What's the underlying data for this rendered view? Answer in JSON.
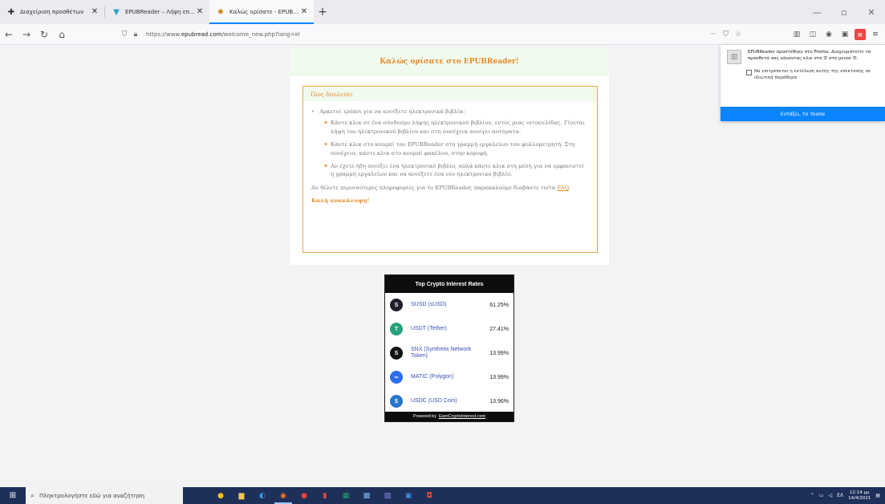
{
  "tabs": [
    {
      "title": "Διαχείριση προσθέτων",
      "icon": "puzzle-icon",
      "active": false
    },
    {
      "title": "EPUBReader – Λήψη επέκταση",
      "icon": "epubreader-icon",
      "active": false
    },
    {
      "title": "Καλώς ορίσατε - EPUBReader",
      "icon": "epubreader-icon",
      "active": true
    }
  ],
  "nav": {
    "url_prefix": "https://www.",
    "url_domain": "epubread.com",
    "url_path": "/welcome_new.php?lang=el",
    "url_more": "···"
  },
  "welcome": {
    "title": "Καλώς ορίσατε στο EPUBReader!",
    "howto_title": "Πώς δουλεύει",
    "intro": "Αρκετοί τρόποι για να ανοίξετε ηλεκτρονικά βιβλία:",
    "steps": [
      "Κάντε κλικ σε ένα σύνδεσμο λήψης ηλεκτρονικού βιβλίου, εντός μιας ιστοσελίδας. Γίνεται λήψη του ηλεκτρονικού βιβλίου και στη συνέχεια ανοίγει αυτόματα.",
      "Κάντε κλικ στο κουμπί του EPUBReader στη γραμμή εργαλείων του φυλλομετρητή. Στη συνέχεια, κάντε κλικ στο κουμπί φακέλου, στην κορυφή.",
      "Αν έχετε ήδη ανοίξει ένα ηλεκτρονικό βιβλίο, απλά κάντε κλικ στη μέση για να εμφανιστεί η γραμμή εργαλείων και να ανοίξετε ένα νέο ηλεκτρονικό βιβλίο."
    ],
    "more_info": "Αν θέλετε περισσότερες πληροφορίες για το EPUBReader, παρακαλούμε διαβάστε το/τα",
    "faq_link": "FAQ",
    "more_info_end": ".",
    "enjoy": "Καλή ανακάλυψη!"
  },
  "crypto": {
    "title": "Top Crypto Interest Rates",
    "rows": [
      {
        "name": "SUSD (sUSD)",
        "rate": "61.25%",
        "icon": "susd-icon",
        "color": "#1f1f2b"
      },
      {
        "name": "USDT (Tether)",
        "rate": "27.41%",
        "icon": "tether-icon",
        "color": "#26a17b"
      },
      {
        "name": "SNX (Synthetix Network Token)",
        "rate": "13.99%",
        "icon": "snx-icon",
        "color": "#111111"
      },
      {
        "name": "MATIC (Polygon)",
        "rate": "13.99%",
        "icon": "polygon-icon",
        "color": "#2b6def"
      },
      {
        "name": "USDC (USD Coin)",
        "rate": "13.96%",
        "icon": "usdc-icon",
        "color": "#2775ca"
      }
    ],
    "footer_prefix": "Powered by",
    "footer_link": "EarnCryptoInterest.com"
  },
  "popup": {
    "text": "EPUBReader προστέθηκε στο Firefox. Διαχειριστείτε τα πρόσθετά σας κάνοντας κλικ στο ☰ στο μενού ☰.",
    "checkbox_label": "Να επιτρέπεται η εκτέλεση αυτής της επέκτασης σε ιδιωτικά παράθυρα",
    "button": "Εντάξει, το 'πιασα"
  },
  "taskbar": {
    "search_placeholder": "Πληκτρολογήστε εδώ για αναζήτηση",
    "language": "ΕΛ",
    "time": "12:14 μμ",
    "date": "14/4/2021"
  }
}
